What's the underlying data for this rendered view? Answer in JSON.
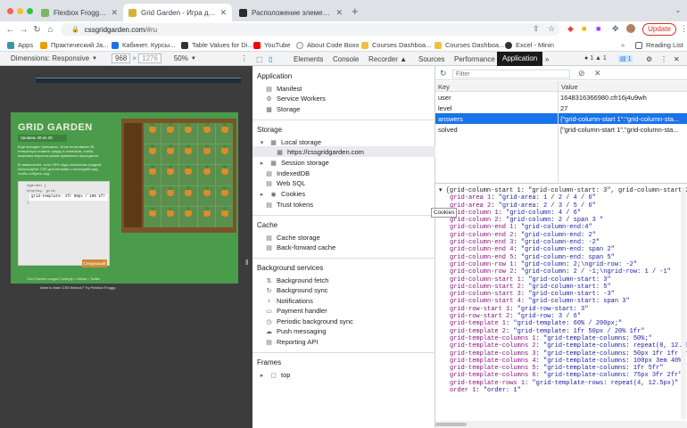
{
  "tabs": [
    {
      "label": "Flexbox Froggy - Игра для изу...",
      "favicon_color": "#7bb662",
      "active": false
    },
    {
      "label": "Grid Garden - Игра для изуче...",
      "favicon_color": "#d9b23a",
      "active": true
    },
    {
      "label": "Расположение элементов по...",
      "favicon_color": "#2a2a2a",
      "active": false
    }
  ],
  "window_controls": {
    "close": "#ff5f57",
    "minimize": "#febc2e",
    "maximize": "#28c840"
  },
  "toolbar": {
    "url_host": "cssgridgarden.com",
    "url_path": "/#ru",
    "update_label": "Update",
    "back_icon": "arrow-left",
    "forward_icon": "arrow-right",
    "reload_icon": "reload"
  },
  "bookmarks": {
    "apps": "Apps",
    "items": [
      "Практический Ja...",
      "Кабинет. Курсы...",
      "Table Values for Di...",
      "YouTube",
      "About Code Boxx",
      "Courses Dashboa...",
      "Courses Dashboa...",
      "Excel - Minin"
    ],
    "reading_list": "Reading List"
  },
  "device_toolbar": {
    "label": "Dimensions: Responsive",
    "width": "968",
    "height": "1276",
    "zoom": "50%"
  },
  "game": {
    "title": "GRID GARDEN",
    "level": "Уровень 28 из 28",
    "intro": "Ещё выпадет тревожить. Блок из вставная 35-генератора ставить грядку в семечков, чтобы морковка выросла разом правильно приходится.",
    "task": "В завершение, если 25% сада заполнены грядкой. Используйте CSS grid-template с последней ряд, чтобы собрать сад.",
    "code_lines": [
      "#garden {",
      "  display: grid;"
    ],
    "input_value": "grid-template: 1fr 50px / 10% 1fr",
    "code_close": "}",
    "next_button": "Следующий",
    "footer1": "Grid Garden создан Codepip • Github • Twitter",
    "footer2": "Want to learn CSS flexbox? Try Flexbox Froggy"
  },
  "devtools": {
    "tabs": [
      "Elements",
      "Console",
      "Recorder ▲",
      "Sources",
      "Performance",
      "Application"
    ],
    "active_tab": "Application",
    "badges": {
      "errors": "1",
      "warnings": "1",
      "info": "1"
    },
    "sidebar": {
      "application": {
        "title": "Application",
        "items": [
          "Manifest",
          "Service Workers",
          "Storage"
        ]
      },
      "storage": {
        "title": "Storage",
        "local_storage": "Local storage",
        "local_origin": "https://cssgridgarden.com",
        "items": [
          "Session storage",
          "IndexedDB",
          "Web SQL",
          "Cookies",
          "Trust tokens"
        ]
      },
      "cache": {
        "title": "Cache",
        "items": [
          "Cache storage",
          "Back-forward cache"
        ]
      },
      "background": {
        "title": "Background services",
        "items": [
          "Background fetch",
          "Background sync",
          "Notifications",
          "Payment handler",
          "Periodic background sync",
          "Push messaging",
          "Reporting API"
        ]
      },
      "frames": {
        "title": "Frames",
        "items": [
          "top"
        ]
      }
    },
    "filter_placeholder": "Filter",
    "table": {
      "headers": [
        "Key",
        "Value"
      ],
      "rows": [
        {
          "key": "user",
          "value": "1648316366980.cfr16j4u9wh"
        },
        {
          "key": "level",
          "value": "27"
        },
        {
          "key": "answers",
          "value": "{\"grid-column-start 1\":\"grid-column-sta..."
        },
        {
          "key": "solved",
          "value": "[\"grid-column-start 1\",\"grid-column-sta..."
        }
      ],
      "selected": "answers"
    },
    "tooltip": "Cookies",
    "json_root": "{grid-column-start 1: \"grid-column-start: 3\", grid-column-start 2: \"",
    "json_lines": [
      [
        "grid-area 1",
        "\"grid-area: 1 / 2 / 4 / 6\""
      ],
      [
        "grid-area 2",
        "\"grid-area: 2 / 3 / 5 / 6\""
      ],
      [
        "grid-column 1",
        "\"grid-column: 4 / 6\""
      ],
      [
        "grid-column 2",
        "\"grid-column: 2 / span 3 \""
      ],
      [
        "grid-column-end 1",
        "\"grid-column-end:4\""
      ],
      [
        "grid-column-end 2",
        "\"grid-column-end: 2\""
      ],
      [
        "grid-column-end 3",
        "\"grid-column-end: -2\""
      ],
      [
        "grid-column-end 4",
        "\"grid-column-end: span 2\""
      ],
      [
        "grid-column-end 5",
        "\"grid-column-end: span 5\""
      ],
      [
        "grid-column-row 1",
        "\"grid-column: 2;\\ngrid-row: -2\""
      ],
      [
        "grid-column-row 2",
        "\"grid-column: 2 / -1;\\ngrid-row: 1 / -1\""
      ],
      [
        "grid-column-start 1",
        "\"grid-column-start: 3\""
      ],
      [
        "grid-column-start 2",
        "\"grid-column-start: 5\""
      ],
      [
        "grid-column-start 3",
        "\"grid-column-start: -3\""
      ],
      [
        "grid-column-start 4",
        "\"grid-column-start: span 3\""
      ],
      [
        "grid-row-start 1",
        "\"grid-row-start: 3\""
      ],
      [
        "grid-row-start 2",
        "\"grid-row: 3 / 6\""
      ],
      [
        "grid-template 1",
        "\"grid-template: 60% / 200px;\""
      ],
      [
        "grid-template 2",
        "\"grid-template: 1fr 50px / 20% 1fr\""
      ],
      [
        "grid-template-columns 1",
        "\"grid-template-columns: 50%;\""
      ],
      [
        "grid-template-columns 2",
        "\"grid-template-columns: repeat(8, 12.5%)\""
      ],
      [
        "grid-template-columns 3",
        "\"grid-template-columns: 50px 1fr 1fr 1fr\""
      ],
      [
        "grid-template-columns 4",
        "\"grid-template-columns: 100px 3em 40%\""
      ],
      [
        "grid-template-columns 5",
        "\"grid-template-columns: 1fr 5fr\""
      ],
      [
        "grid-template-columns 6",
        "\"grid-template-columns: 75px 3fr 2fr\""
      ],
      [
        "grid-template-rows 1",
        "\"grid-template-rows: repeat(4, 12.5px)\""
      ],
      [
        "order 1",
        "\"order: 1\""
      ]
    ]
  }
}
